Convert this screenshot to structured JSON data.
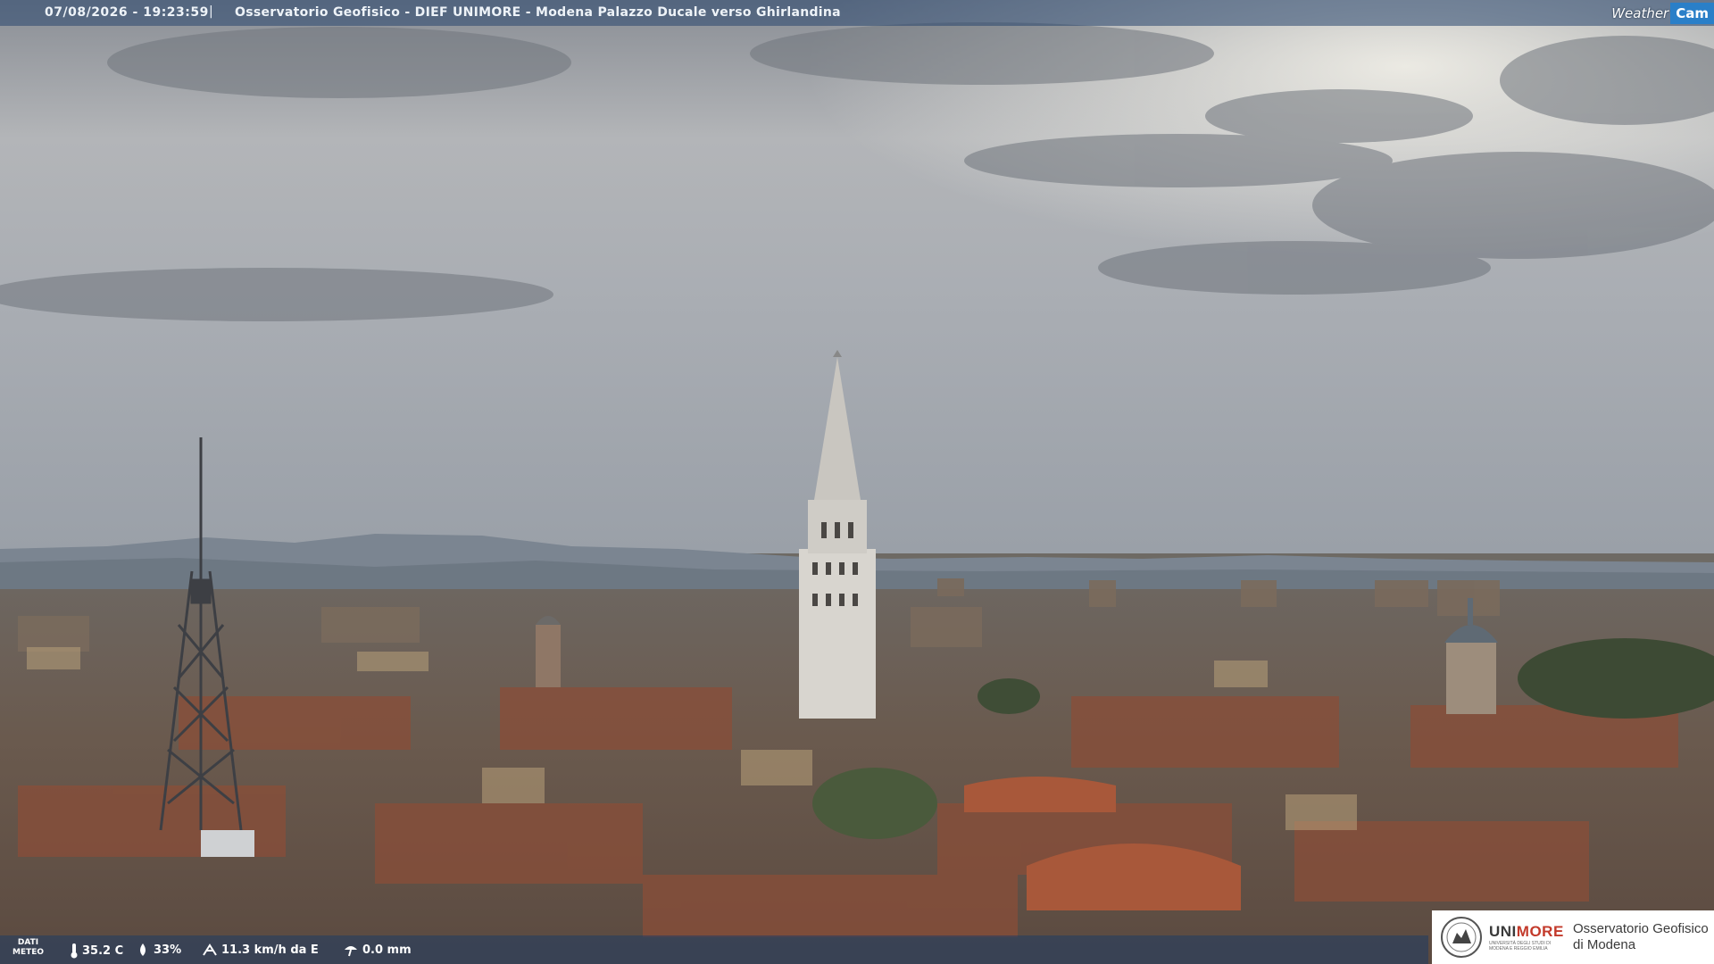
{
  "overlay": {
    "timestamp": "07/08/2026 - 19:23:59",
    "separator": "|",
    "title": "Osservatorio Geofisico - DIEF UNIMORE - Modena Palazzo Ducale verso Ghirlandina",
    "brand_weather": "Weather",
    "brand_cam": "Cam"
  },
  "weather": {
    "label_line1": "DATI",
    "label_line2": "METEO",
    "temperature": "35.2 C",
    "humidity": "33%",
    "wind": "11.3 km/h da E",
    "rain": "0.0 mm",
    "temperature_icon": "thermometer-icon",
    "humidity_icon": "droplet-icon",
    "wind_icon": "wind-icon",
    "rain_icon": "rain-gauge-icon"
  },
  "logo": {
    "unimore_1": "UNI",
    "unimore_2": "MORE",
    "unimore_sub": "UNIVERSITÀ DEGLI STUDI DI MODENA E REGGIO EMILIA",
    "observatory_line1": "Osservatorio Geofisico",
    "observatory_line2": "di Modena"
  },
  "colors": {
    "accent_red": "#c33a2b",
    "brand_blue": "#2a7fc8"
  }
}
